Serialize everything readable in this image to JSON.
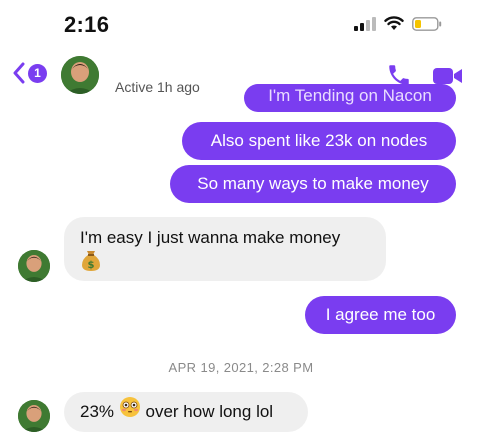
{
  "status_bar": {
    "time": "2:16"
  },
  "header": {
    "back_count": "1",
    "active_status": "Active 1h ago"
  },
  "messages": [
    {
      "direction": "sent",
      "text": "I'm Tending on Nacon",
      "partial": true
    },
    {
      "direction": "sent",
      "text": "Also spent like 23k on nodes"
    },
    {
      "direction": "sent",
      "text": "So many ways to make money"
    },
    {
      "direction": "received",
      "text": "I'm easy I just wanna make money",
      "emoji": "money-bag"
    },
    {
      "direction": "sent",
      "text": "I agree me too"
    },
    {
      "direction": "received",
      "text_before": "23%",
      "emoji": "flushed-face",
      "text_after": "over how long lol"
    }
  ],
  "timestamp": "APR 19, 2021, 2:28 PM",
  "colors": {
    "accent": "#7a3df0",
    "received_bubble": "#efefef",
    "timestamp": "#8a8a8a"
  }
}
